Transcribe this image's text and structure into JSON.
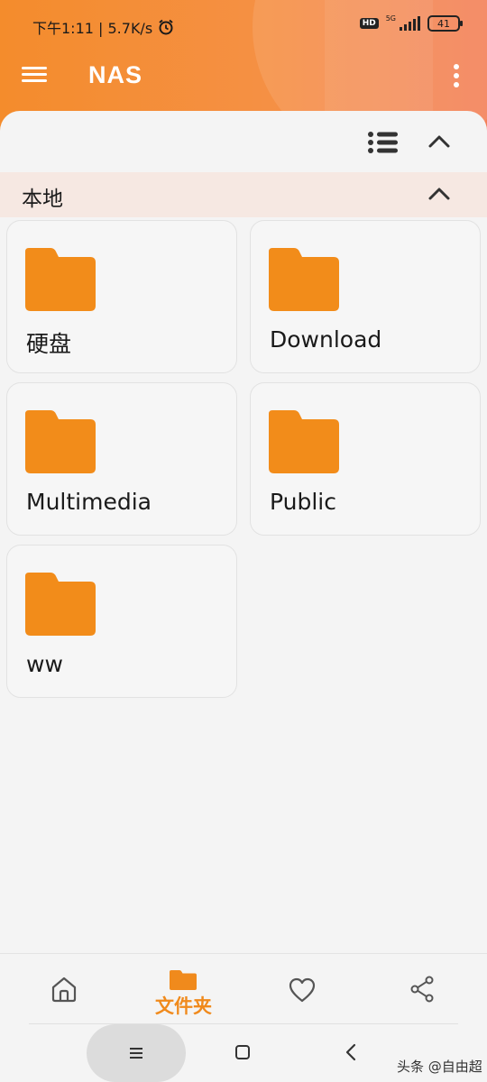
{
  "status_bar": {
    "time_and_speed": "下午1:11 | 5.7K/s",
    "hd": "HD",
    "network": "5G",
    "battery": "41"
  },
  "app_bar": {
    "title": "NAS",
    "menu_icon": "hamburger-menu-icon",
    "more_icon": "vertical-dots-icon"
  },
  "toolbar": {
    "view_icon": "list-view-icon",
    "collapse_icon": "chevron-up-icon"
  },
  "section": {
    "title": "本地",
    "collapse_icon": "chevron-up-icon"
  },
  "folders": [
    {
      "name": "硬盘",
      "icon": "folder-icon"
    },
    {
      "name": "Download",
      "icon": "folder-icon"
    },
    {
      "name": "Multimedia",
      "icon": "folder-icon"
    },
    {
      "name": "Public",
      "icon": "folder-icon"
    },
    {
      "name": "ww",
      "icon": "folder-icon"
    }
  ],
  "bottom_nav": {
    "items": [
      {
        "icon": "home-icon",
        "label": ""
      },
      {
        "icon": "folder-icon",
        "label": "文件夹",
        "active": true
      },
      {
        "icon": "heart-icon",
        "label": ""
      },
      {
        "icon": "share-icon",
        "label": ""
      }
    ]
  },
  "colors": {
    "accent": "#f08a1c",
    "folder": "#f28c1a",
    "header_start": "#f48c2c",
    "header_end": "#f38158"
  },
  "watermark": "头条 @自由超"
}
